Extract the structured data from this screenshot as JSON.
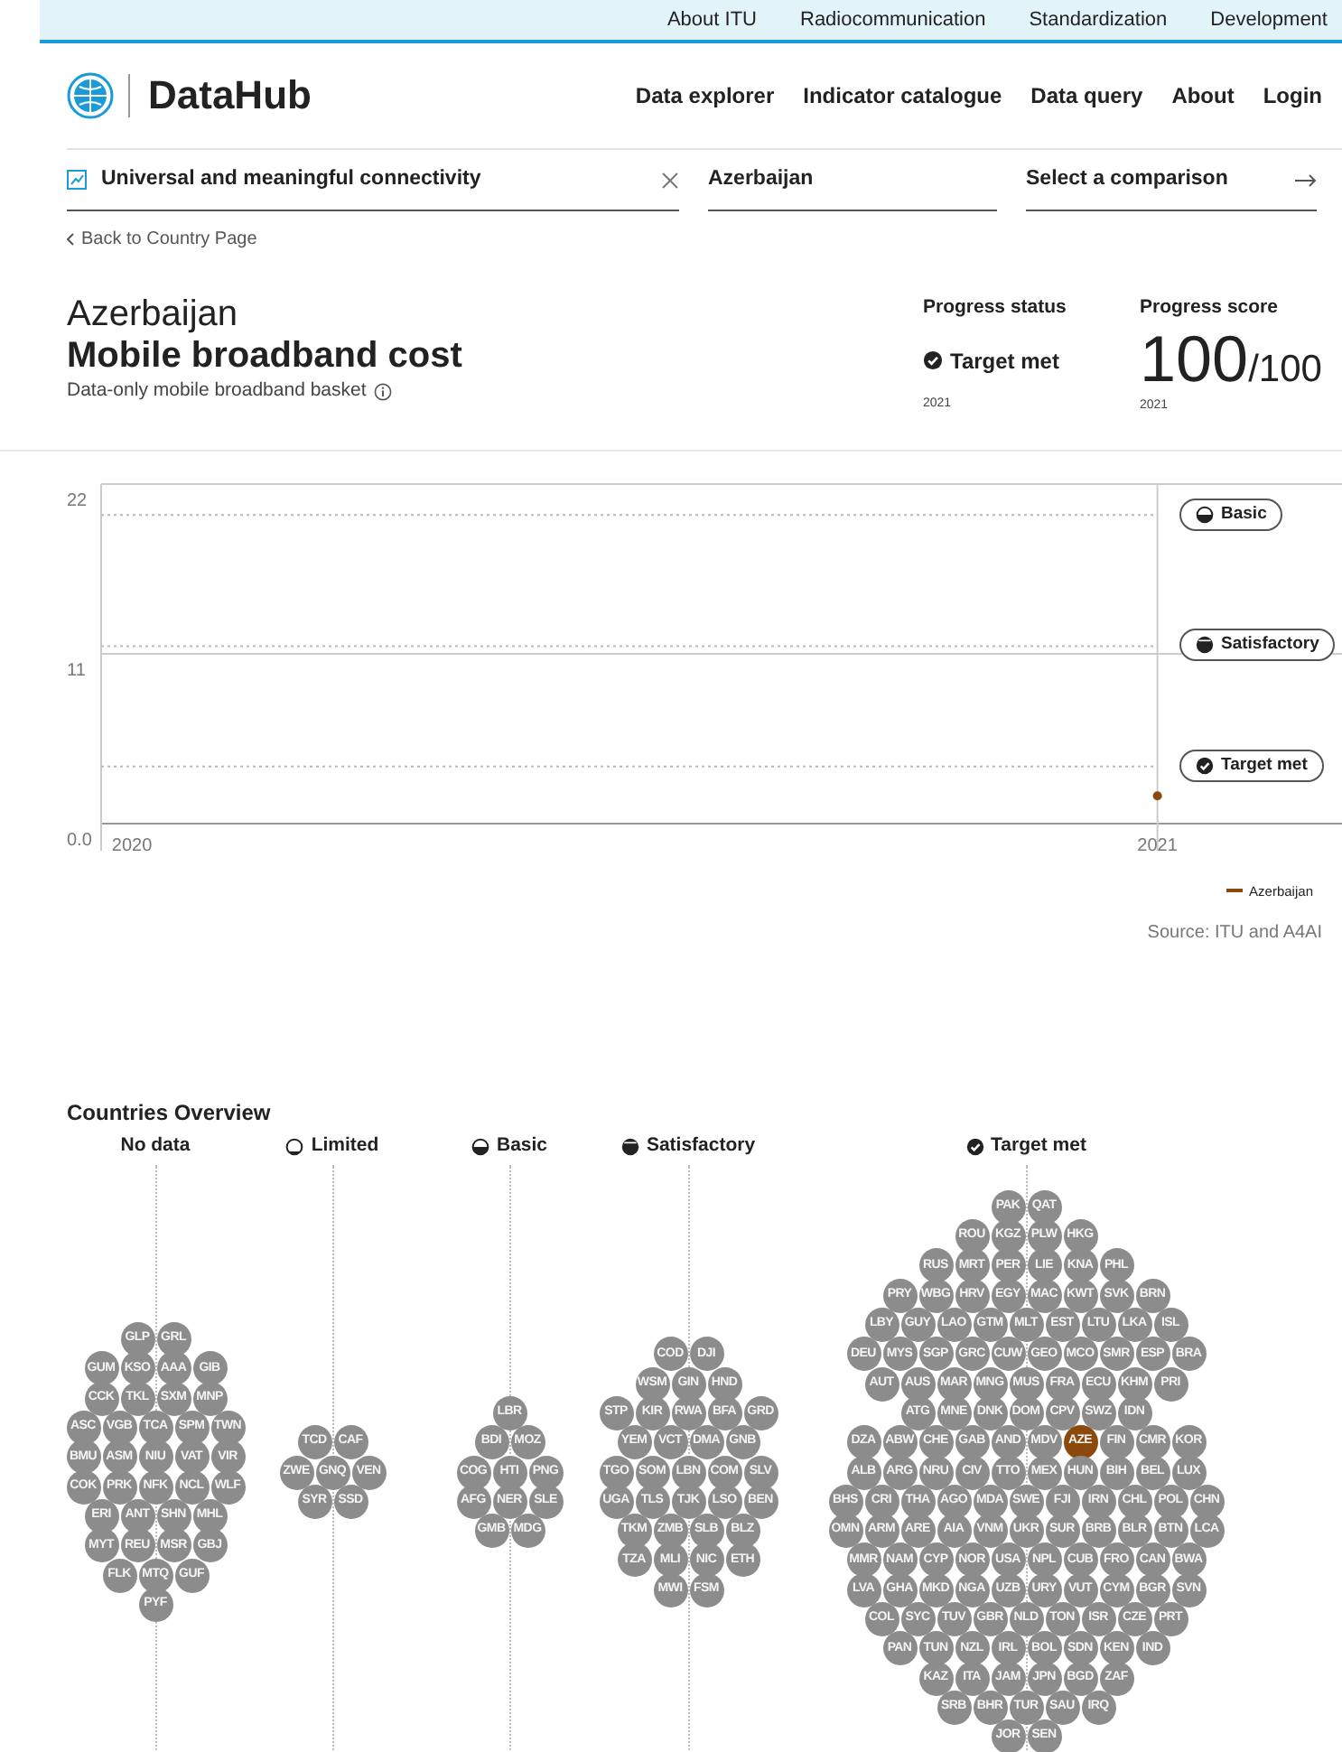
{
  "top_links": [
    "About ITU",
    "Radiocommunication",
    "Standardization",
    "Development"
  ],
  "logo": {
    "name": "DataHub"
  },
  "nav": [
    "Data explorer",
    "Indicator catalogue",
    "Data query",
    "About",
    "Login"
  ],
  "selectors": [
    {
      "kind": "topic",
      "value": "Universal and meaningful connectivity",
      "clearable": true
    },
    {
      "kind": "country",
      "value": "Azerbaijan",
      "clearable": false
    },
    {
      "kind": "comparison",
      "placeholder": "Select a comparison",
      "clearable": false
    }
  ],
  "back_link": "Back to Country Page",
  "country": "Azerbaijan",
  "indicator": "Mobile broadband cost",
  "subtitle": "Data-only mobile broadband basket",
  "progress_status": {
    "label": "Progress status",
    "kind": "target",
    "text": "Target met",
    "year": "2021"
  },
  "progress_score": {
    "label": "Progress score",
    "value": "100",
    "max": "/100",
    "year": "2021"
  },
  "chart": {
    "chart_data": {
      "type": "line",
      "x": [
        2021
      ],
      "series": [
        {
          "name": "Azerbaijan",
          "color": "#8b4a0c",
          "values": [
            1.8
          ],
          "marker": true
        }
      ],
      "xlim": [
        2019.97,
        2021.18
      ],
      "ylim": [
        0,
        22
      ],
      "yticks": [
        {
          "value": 0,
          "label": "0.0"
        },
        11,
        22
      ],
      "xticks": [
        2020,
        2021
      ],
      "ref_lines": [
        {
          "axis": "y",
          "value": 20,
          "label": "Basic"
        },
        {
          "axis": "y",
          "value": 11.5,
          "label": "Satisfactory"
        },
        {
          "axis": "y",
          "value": 3.7,
          "label": "Target met"
        }
      ]
    },
    "thresholds": [
      {
        "kind": "basic"
      },
      {
        "kind": "satisfactory"
      },
      {
        "kind": "target"
      }
    ],
    "source": "Source: ITU and A4AI"
  },
  "overview": {
    "title": "Countries Overview",
    "groups": [
      {
        "kind": "none",
        "label": "No data",
        "rows": [
          [
            "GLP",
            "GRL"
          ],
          [
            "GUM",
            "KSO",
            "AAA",
            "GIB"
          ],
          [
            "CCK",
            "TKL",
            "SXM",
            "MNP"
          ],
          [
            "ASC",
            "VGB",
            "TCA",
            "SPM",
            "TWN"
          ],
          [
            "BMU",
            "ASM",
            "NIU",
            "VAT",
            "VIR"
          ],
          [
            "COK",
            "PRK",
            "NFK",
            "NCL",
            "WLF"
          ],
          [
            "ERI",
            "ANT",
            "SHN",
            "MHL"
          ],
          [
            "MYT",
            "REU",
            "MSR",
            "GBJ"
          ],
          [
            "FLK",
            "MTQ",
            "GUF"
          ],
          [
            "PYF"
          ]
        ]
      },
      {
        "kind": "limited",
        "label": "Limited",
        "rows": [
          [
            "TCD",
            "CAF"
          ],
          [
            "ZWE",
            "GNQ",
            "VEN"
          ],
          [
            "SYR",
            "SSD"
          ]
        ]
      },
      {
        "kind": "basic",
        "label": "Basic",
        "rows": [
          [
            "LBR"
          ],
          [
            "BDI",
            "MOZ"
          ],
          [
            "COG",
            "HTI",
            "PNG"
          ],
          [
            "AFG",
            "NER",
            "SLE"
          ],
          [
            "GMB",
            "MDG"
          ]
        ]
      },
      {
        "kind": "satisfactory",
        "label": "Satisfactory",
        "rows": [
          [
            "COD",
            "DJI"
          ],
          [
            "WSM",
            "GIN",
            "HND"
          ],
          [
            "STP",
            "KIR",
            "RWA",
            "BFA",
            "GRD"
          ],
          [
            "YEM",
            "VCT",
            "DMA",
            "GNB"
          ],
          [
            "TGO",
            "SOM",
            "LBN",
            "COM",
            "SLV"
          ],
          [
            "UGA",
            "TLS",
            "TJK",
            "LSO",
            "BEN"
          ],
          [
            "TKM",
            "ZMB",
            "SLB",
            "BLZ"
          ],
          [
            "TZA",
            "MLI",
            "NIC",
            "ETH"
          ],
          [
            "MWI",
            "FSM"
          ]
        ]
      },
      {
        "kind": "target",
        "label": "Target met",
        "rows": [
          [
            "PAK",
            "QAT"
          ],
          [
            "ROU",
            "KGZ",
            "PLW",
            "HKG"
          ],
          [
            "RUS",
            "MRT",
            "PER",
            "LIE",
            "KNA",
            "PHL"
          ],
          [
            "PRY",
            "WBG",
            "HRV",
            "EGY",
            "MAC",
            "KWT",
            "SVK",
            "BRN"
          ],
          [
            "LBY",
            "GUY",
            "LAO",
            "GTM",
            "MLT",
            "EST",
            "LTU",
            "LKA",
            "ISL"
          ],
          [
            "DEU",
            "MYS",
            "SGP",
            "GRC",
            "CUW",
            "GEO",
            "MCO",
            "SMR",
            "ESP",
            "BRA"
          ],
          [
            "AUT",
            "AUS",
            "MAR",
            "MNG",
            "MUS",
            "FRA",
            "ECU",
            "KHM",
            "PRI"
          ],
          [
            "ATG",
            "MNE",
            "DNK",
            "DOM",
            "CPV",
            "SWZ",
            "IDN"
          ],
          [
            "DZA",
            "ABW",
            "CHE",
            "GAB",
            "AND",
            "MDV",
            {
              "code": "AZE",
              "color": "#8b4a0c"
            },
            "FIN",
            "CMR",
            "KOR"
          ],
          [
            "ALB",
            "ARG",
            "NRU",
            "CIV",
            "TTO",
            "MEX",
            "HUN",
            "BIH",
            "BEL",
            "LUX"
          ],
          [
            "BHS",
            "CRI",
            "THA",
            "AGO",
            "MDA",
            "SWE",
            "FJI",
            "IRN",
            "CHL",
            "POL",
            "CHN"
          ],
          [
            "OMN",
            "ARM",
            "ARE",
            "AIA",
            "VNM",
            "UKR",
            "SUR",
            "BRB",
            "BLR",
            "BTN",
            "LCA"
          ],
          [
            "MMR",
            "NAM",
            "CYP",
            "NOR",
            "USA",
            "NPL",
            "CUB",
            "FRO",
            "CAN",
            "BWA"
          ],
          [
            "LVA",
            "GHA",
            "MKD",
            "NGA",
            "UZB",
            "URY",
            "VUT",
            "CYM",
            "BGR",
            "SVN"
          ],
          [
            "COL",
            "SYC",
            "TUV",
            "GBR",
            "NLD",
            "TON",
            "ISR",
            "CZE",
            "PRT"
          ],
          [
            "PAN",
            "TUN",
            "NZL",
            "IRL",
            "BOL",
            "SDN",
            "KEN",
            "IND"
          ],
          [
            "KAZ",
            "ITA",
            "JAM",
            "JPN",
            "BGD",
            "ZAF"
          ],
          [
            "SRB",
            "BHR",
            "TUR",
            "SAU",
            "IRQ"
          ],
          [
            "JOR",
            "SEN"
          ]
        ]
      }
    ]
  }
}
